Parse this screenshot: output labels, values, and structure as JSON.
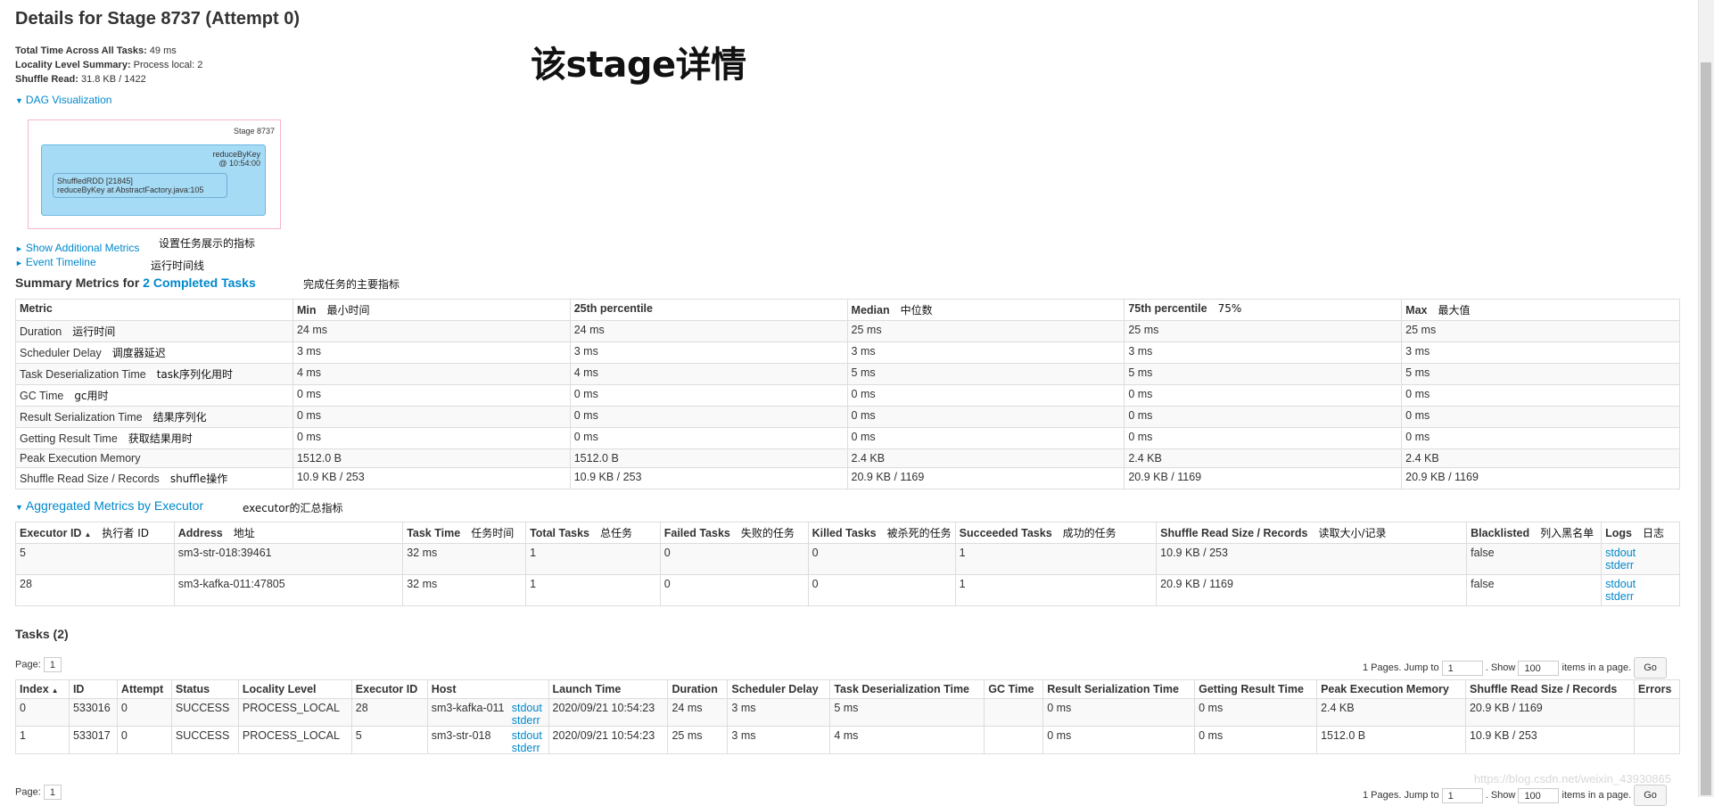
{
  "page_title": "Details for Stage 8737 (Attempt 0)",
  "big_note": "该stage详情",
  "summary": {
    "total_time_label": "Total Time Across All Tasks:",
    "total_time_value": "49 ms",
    "locality_label": "Locality Level Summary:",
    "locality_value": "Process local: 2",
    "shuffle_label": "Shuffle Read:",
    "shuffle_value": "31.8 KB / 1422"
  },
  "dag": {
    "toggle_label": "DAG Visualization",
    "stage_label": "Stage 8737",
    "op_line1": "reduceByKey",
    "op_line2": "@ 10:54:00",
    "rdd_line1": "ShuffledRDD [21845]",
    "rdd_line2": "reduceByKey at AbstractFactory.java:105"
  },
  "links": {
    "show_metrics": "Show Additional Metrics",
    "show_metrics_note": "设置任务展示的指标",
    "event_timeline": "Event Timeline",
    "event_timeline_note": "运行时间线"
  },
  "summary_metrics": {
    "title_prefix": "Summary Metrics for ",
    "title_link": "2 Completed Tasks",
    "title_note": "完成任务的主要指标",
    "headers": [
      {
        "label": "Metric",
        "note": ""
      },
      {
        "label": "Min",
        "note": "最小时间"
      },
      {
        "label": "25th percentile",
        "note": ""
      },
      {
        "label": "Median",
        "note": "中位数"
      },
      {
        "label": "75th percentile",
        "note": "75%"
      },
      {
        "label": "Max",
        "note": "最大值"
      }
    ],
    "rows": [
      {
        "metric": "Duration",
        "note": "运行时间",
        "values": [
          "24 ms",
          "24 ms",
          "25 ms",
          "25 ms",
          "25 ms"
        ]
      },
      {
        "metric": "Scheduler Delay",
        "note": "调度器延迟",
        "values": [
          "3 ms",
          "3 ms",
          "3 ms",
          "3 ms",
          "3 ms"
        ]
      },
      {
        "metric": "Task Deserialization Time",
        "note": "task序列化用时",
        "values": [
          "4 ms",
          "4 ms",
          "5 ms",
          "5 ms",
          "5 ms"
        ]
      },
      {
        "metric": "GC Time",
        "note": "gc用时",
        "values": [
          "0 ms",
          "0 ms",
          "0 ms",
          "0 ms",
          "0 ms"
        ]
      },
      {
        "metric": "Result Serialization Time",
        "note": "结果序列化",
        "values": [
          "0 ms",
          "0 ms",
          "0 ms",
          "0 ms",
          "0 ms"
        ]
      },
      {
        "metric": "Getting Result Time",
        "note": "获取结果用时",
        "values": [
          "0 ms",
          "0 ms",
          "0 ms",
          "0 ms",
          "0 ms"
        ]
      },
      {
        "metric": "Peak Execution Memory",
        "note": "",
        "values": [
          "1512.0 B",
          "1512.0 B",
          "2.4 KB",
          "2.4 KB",
          "2.4 KB"
        ]
      },
      {
        "metric": "Shuffle Read Size / Records",
        "note": "shuffle操作",
        "values": [
          "10.9 KB / 253",
          "10.9 KB / 253",
          "20.9 KB / 1169",
          "20.9 KB / 1169",
          "20.9 KB / 1169"
        ]
      }
    ]
  },
  "aggregated": {
    "title": "Aggregated Metrics by Executor",
    "title_note": "executor的汇总指标",
    "headers": [
      {
        "label": "Executor ID",
        "note": "执行者 ID"
      },
      {
        "label": "Address",
        "note": "地址"
      },
      {
        "label": "Task Time",
        "note": "任务时间"
      },
      {
        "label": "Total Tasks",
        "note": "总任务"
      },
      {
        "label": "Failed Tasks",
        "note": "失败的任务"
      },
      {
        "label": "Killed Tasks",
        "note": "被杀死的任务"
      },
      {
        "label": "Succeeded Tasks",
        "note": "成功的任务"
      },
      {
        "label": "Shuffle Read Size / Records",
        "note": "读取大小/记录"
      },
      {
        "label": "Blacklisted",
        "note": "列入黑名单"
      },
      {
        "label": "Logs",
        "note": "日志"
      }
    ],
    "rows": [
      {
        "executor_id": "5",
        "address": "sm3-str-018:39461",
        "task_time": "32 ms",
        "total": "1",
        "failed": "0",
        "killed": "0",
        "succeeded": "1",
        "shuffle": "10.9 KB / 253",
        "blacklisted": "false",
        "stdout": "stdout",
        "stderr": "stderr"
      },
      {
        "executor_id": "28",
        "address": "sm3-kafka-011:47805",
        "task_time": "32 ms",
        "total": "1",
        "failed": "0",
        "killed": "0",
        "succeeded": "1",
        "shuffle": "20.9 KB / 1169",
        "blacklisted": "false",
        "stdout": "stdout",
        "stderr": "stderr"
      }
    ]
  },
  "tasks": {
    "title": "Tasks (2)",
    "page_label": "Page:",
    "page_value": "1",
    "pages_text": "1 Pages. Jump to",
    "jump_value": "1",
    "show_label": ". Show",
    "show_value": "100",
    "items_label": "items in a page.",
    "go_label": "Go",
    "headers": [
      "Index",
      "ID",
      "Attempt",
      "Status",
      "Locality Level",
      "Executor ID",
      "Host",
      "Launch Time",
      "Duration",
      "Scheduler Delay",
      "Task Deserialization Time",
      "GC Time",
      "Result Serialization Time",
      "Getting Result Time",
      "Peak Execution Memory",
      "Shuffle Read Size / Records",
      "Errors"
    ],
    "rows": [
      {
        "index": "0",
        "id": "533016",
        "attempt": "0",
        "status": "SUCCESS",
        "locality": "PROCESS_LOCAL",
        "executor": "28",
        "host": "sm3-kafka-011",
        "stdout": "stdout",
        "stderr": "stderr",
        "launch": "2020/09/21 10:54:23",
        "duration": "24 ms",
        "sched": "3 ms",
        "deser": "5 ms",
        "gc": "",
        "resser": "0 ms",
        "getres": "0 ms",
        "peak": "2.4 KB",
        "shuffle": "20.9 KB / 1169",
        "errors": ""
      },
      {
        "index": "1",
        "id": "533017",
        "attempt": "0",
        "status": "SUCCESS",
        "locality": "PROCESS_LOCAL",
        "executor": "5",
        "host": "sm3-str-018",
        "stdout": "stdout",
        "stderr": "stderr",
        "launch": "2020/09/21 10:54:23",
        "duration": "25 ms",
        "sched": "3 ms",
        "deser": "4 ms",
        "gc": "",
        "resser": "0 ms",
        "getres": "0 ms",
        "peak": "1512.0 B",
        "shuffle": "10.9 KB / 253",
        "errors": ""
      }
    ]
  },
  "watermark": "https://blog.csdn.net/weixin_43930865"
}
